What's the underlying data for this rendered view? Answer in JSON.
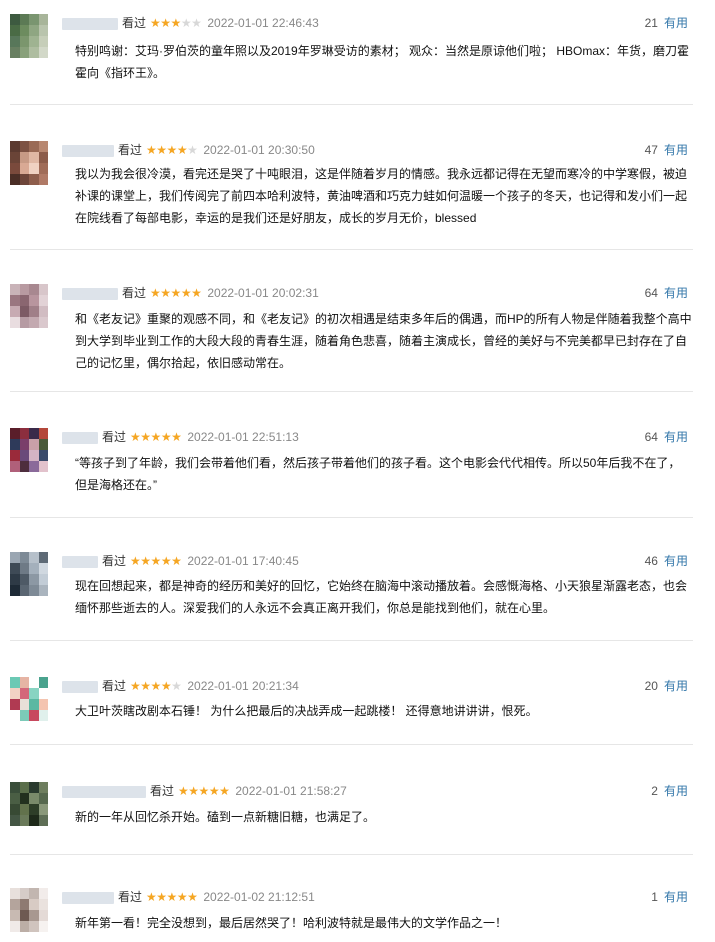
{
  "useful_label": "有用",
  "star_on_color": "#f5a623",
  "star_off_color": "#d8d8d8",
  "link_color": "#3377aa",
  "reviews": [
    {
      "watched": "看过",
      "rating": 3,
      "time": "2022-01-01 22:46:43",
      "votes": "21",
      "content": "特别鸣谢：艾玛·罗伯茨的童年照以及2019年罗琳受访的素材； 观众：当然是原谅他们啦； HBOmax：年货，磨刀霍霍向《指环王》。"
    },
    {
      "watched": "看过",
      "rating": 4,
      "time": "2022-01-01 20:30:50",
      "votes": "47",
      "content": "我以为我会很冷漠，看完还是哭了十吨眼泪，这是伴随着岁月的情感。我永远都记得在无望而寒冷的中学寒假，被迫补课的课堂上，我们传阅完了前四本哈利波特，黄油啤酒和巧克力蛙如何温暖一个孩子的冬天，也记得和发小们一起在院线看了每部电影，幸运的是我们还是好朋友，成长的岁月无价，blessed"
    },
    {
      "watched": "看过",
      "rating": 5,
      "time": "2022-01-01 20:02:31",
      "votes": "64",
      "content": "和《老友记》重聚的观感不同，和《老友记》的初次相遇是结束多年后的偶遇，而HP的所有人物是伴随着我整个高中到大学到毕业到工作的大段大段的青春生涯，随着角色悲喜，随着主演成长，曾经的美好与不完美都早已封存在了自己的记忆里，偶尔拾起，依旧感动常在。"
    },
    {
      "watched": "看过",
      "rating": 5,
      "time": "2022-01-01 22:51:13",
      "votes": "64",
      "content": "“等孩子到了年龄，我们会带着他们看，然后孩子带着他们的孩子看。这个电影会代代相传。所以50年后我不在了，但是海格还在。”"
    },
    {
      "watched": "看过",
      "rating": 5,
      "time": "2022-01-01 17:40:45",
      "votes": "46",
      "content": "现在回想起来，都是神奇的经历和美好的回忆，它始终在脑海中滚动播放着。会感慨海格、小天狼星渐露老态，也会缅怀那些逝去的人。深爱我们的人永远不会真正离开我们，你总是能找到他们，就在心里。"
    },
    {
      "watched": "看过",
      "rating": 4,
      "time": "2022-01-01 20:21:34",
      "votes": "20",
      "content": "大卫叶茨瞎改剧本石锤！ 为什么把最后的决战弄成一起跳楼！ 还得意地讲讲讲，恨死。"
    },
    {
      "watched": "看过",
      "rating": 5,
      "time": "2022-01-01 21:58:27",
      "votes": "2",
      "content": "新的一年从回忆杀开始。磕到一点新糖旧糖，也满足了。"
    },
    {
      "watched": "看过",
      "rating": 5,
      "time": "2022-01-02 21:12:51",
      "votes": "1",
      "content": "新年第一看！完全没想到，最后居然哭了！哈利波特就是最伟大的文学作品之一！"
    }
  ]
}
